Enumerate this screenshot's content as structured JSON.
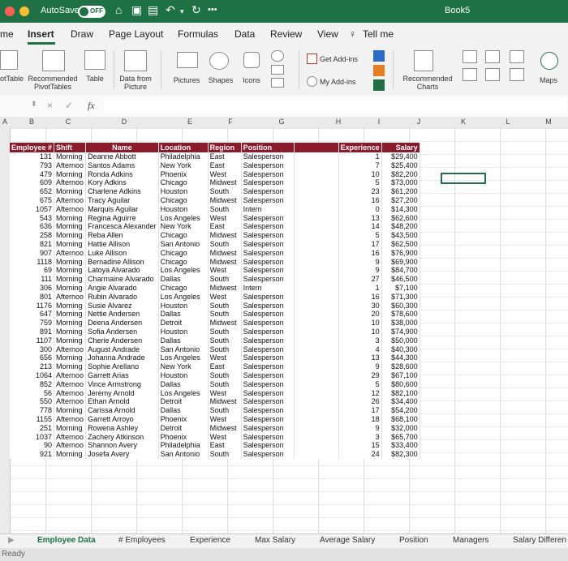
{
  "window": {
    "autosave_label": "AutoSave",
    "autosave_state": "OFF",
    "more": "•••",
    "title": "Book5"
  },
  "tabs": [
    "me",
    "Insert",
    "Draw",
    "Page Layout",
    "Formulas",
    "Data",
    "Review",
    "View"
  ],
  "tell_me": "Tell me",
  "ribbon": {
    "pivot_label_1": "otTable",
    "rec_pivot_1": "Recommended",
    "rec_pivot_2": "PivotTables",
    "table": "Table",
    "data_from_picture_1": "Data from",
    "data_from_picture_2": "Picture",
    "pictures": "Pictures",
    "shapes": "Shapes",
    "icons": "Icons",
    "get_addins": "Get Add-ins",
    "my_addins": "My Add-ins",
    "rec_charts_1": "Recommended",
    "rec_charts_2": "Charts",
    "maps": "Maps"
  },
  "formula_bar": {
    "fx": "fx",
    "cancel": "×",
    "confirm": "✓"
  },
  "columns": [
    "A",
    "B",
    "C",
    "D",
    "E",
    "F",
    "G",
    "H",
    "I",
    "J",
    "K",
    "L",
    "M"
  ],
  "table": {
    "headers": [
      "Employee #",
      "Shift",
      "Name",
      "Location",
      "Region",
      "Position",
      "",
      "Experience",
      "Salary"
    ],
    "rows": [
      [
        "131",
        "Morning",
        "Deanne Abbott",
        "Philadelphia",
        "East",
        "Salesperson",
        "",
        "1",
        "$29,400"
      ],
      [
        "793",
        "Afternoo",
        "Santos Adams",
        "New York",
        "East",
        "Salesperson",
        "",
        "7",
        "$25,400"
      ],
      [
        "479",
        "Morning",
        "Ronda Adkins",
        "Phoenix",
        "West",
        "Salesperson",
        "",
        "10",
        "$82,200"
      ],
      [
        "609",
        "Afternoo",
        "Kory Adkins",
        "Chicago",
        "Midwest",
        "Salesperson",
        "",
        "5",
        "$73,000"
      ],
      [
        "652",
        "Morning",
        "Charlene Adkins",
        "Houston",
        "South",
        "Salesperson",
        "",
        "23",
        "$61,200"
      ],
      [
        "675",
        "Afternoo",
        "Tracy Aguilar",
        "Chicago",
        "Midwest",
        "Salesperson",
        "",
        "16",
        "$27,200"
      ],
      [
        "1057",
        "Afternoo",
        "Marquis Aguilar",
        "Houston",
        "South",
        "Intern",
        "",
        "0",
        "$14,300"
      ],
      [
        "543",
        "Morning",
        "Regina Aguirre",
        "Los Angeles",
        "West",
        "Salesperson",
        "",
        "13",
        "$62,600"
      ],
      [
        "636",
        "Morning",
        "Francesca Alexander",
        "New York",
        "East",
        "Salesperson",
        "",
        "14",
        "$48,200"
      ],
      [
        "258",
        "Morning",
        "Reba Allen",
        "Chicago",
        "Midwest",
        "Salesperson",
        "",
        "5",
        "$43,500"
      ],
      [
        "821",
        "Morning",
        "Hattie Allison",
        "San Antonio",
        "South",
        "Salesperson",
        "",
        "17",
        "$62,500"
      ],
      [
        "907",
        "Afternoo",
        "Luke Allison",
        "Chicago",
        "Midwest",
        "Salesperson",
        "",
        "16",
        "$76,900"
      ],
      [
        "1118",
        "Morning",
        "Bernadine Allison",
        "Chicago",
        "Midwest",
        "Salesperson",
        "",
        "9",
        "$69,900"
      ],
      [
        "69",
        "Morning",
        "Latoya Alvarado",
        "Los Angeles",
        "West",
        "Salesperson",
        "",
        "9",
        "$84,700"
      ],
      [
        "111",
        "Morning",
        "Charmaine Alvarado",
        "Dallas",
        "South",
        "Salesperson",
        "",
        "27",
        "$46,500"
      ],
      [
        "306",
        "Morning",
        "Angie Alvarado",
        "Chicago",
        "Midwest",
        "Intern",
        "",
        "1",
        "$7,100"
      ],
      [
        "801",
        "Afternoo",
        "Rubin Alvarado",
        "Los Angeles",
        "West",
        "Salesperson",
        "",
        "16",
        "$71,300"
      ],
      [
        "1176",
        "Morning",
        "Susie Alvarez",
        "Houston",
        "South",
        "Salesperson",
        "",
        "30",
        "$60,300"
      ],
      [
        "647",
        "Morning",
        "Nettie Andersen",
        "Dallas",
        "South",
        "Salesperson",
        "",
        "20",
        "$78,600"
      ],
      [
        "759",
        "Morning",
        "Deena Andersen",
        "Detroit",
        "Midwest",
        "Salesperson",
        "",
        "10",
        "$38,000"
      ],
      [
        "891",
        "Morning",
        "Sofia Andersen",
        "Houston",
        "South",
        "Salesperson",
        "",
        "10",
        "$74,900"
      ],
      [
        "1107",
        "Morning",
        "Cherie Andersen",
        "Dallas",
        "South",
        "Salesperson",
        "",
        "3",
        "$50,000"
      ],
      [
        "300",
        "Afternoo",
        "August Andrade",
        "San Antonio",
        "South",
        "Salesperson",
        "",
        "4",
        "$40,300"
      ],
      [
        "656",
        "Morning",
        "Johanna Andrade",
        "Los Angeles",
        "West",
        "Salesperson",
        "",
        "13",
        "$44,300"
      ],
      [
        "213",
        "Morning",
        "Sophie Arellano",
        "New York",
        "East",
        "Salesperson",
        "",
        "9",
        "$28,600"
      ],
      [
        "1064",
        "Afternoo",
        "Garrett Arias",
        "Houston",
        "South",
        "Salesperson",
        "",
        "29",
        "$67,100"
      ],
      [
        "852",
        "Afternoo",
        "Vince Armstrong",
        "Dallas",
        "South",
        "Salesperson",
        "",
        "5",
        "$80,600"
      ],
      [
        "56",
        "Afternoo",
        "Jeremy Arnold",
        "Los Angeles",
        "West",
        "Salesperson",
        "",
        "12",
        "$82,100"
      ],
      [
        "550",
        "Afternoo",
        "Ethan Arnold",
        "Detroit",
        "Midwest",
        "Salesperson",
        "",
        "26",
        "$34,400"
      ],
      [
        "778",
        "Morning",
        "Carissa Arnold",
        "Dallas",
        "South",
        "Salesperson",
        "",
        "17",
        "$54,200"
      ],
      [
        "1155",
        "Afternoo",
        "Garrett Arroyo",
        "Phoenix",
        "West",
        "Salesperson",
        "",
        "18",
        "$68,100"
      ],
      [
        "251",
        "Morning",
        "Rowena Ashley",
        "Detroit",
        "Midwest",
        "Salesperson",
        "",
        "9",
        "$32,000"
      ],
      [
        "1037",
        "Afternoo",
        "Zachery Atkinson",
        "Phoenix",
        "West",
        "Salesperson",
        "",
        "3",
        "$65,700"
      ],
      [
        "90",
        "Afternoo",
        "Shannon Avery",
        "Philadelphia",
        "East",
        "Salesperson",
        "",
        "15",
        "$33,400"
      ],
      [
        "921",
        "Morning",
        "Josefa Avery",
        "San Antonio",
        "South",
        "Salesperson",
        "",
        "24",
        "$82,300"
      ]
    ]
  },
  "sheet_tabs": [
    "Employee Data",
    "# Employees",
    "Experience",
    "Max Salary",
    "Average Salary",
    "Position",
    "Managers",
    "Salary Differen"
  ],
  "status": "Ready",
  "colors": {
    "brand": "#1e7145",
    "header_fill": "#8b1a2b"
  }
}
